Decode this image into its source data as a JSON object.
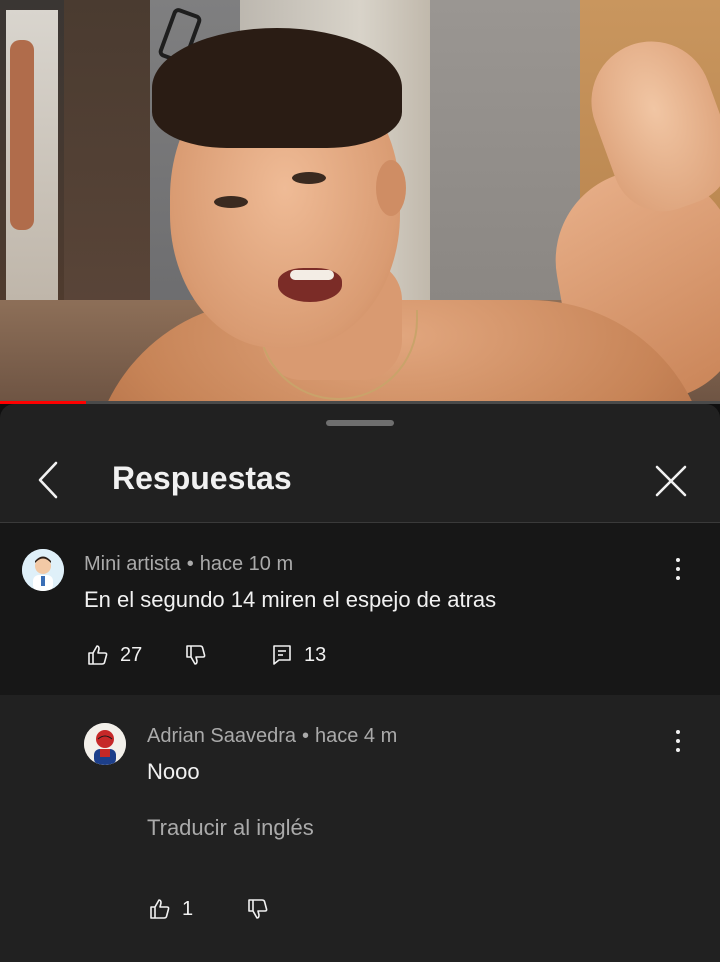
{
  "video": {
    "progress": 0.12
  },
  "panel": {
    "title": "Respuestas"
  },
  "parent_comment": {
    "author": "Mini artista",
    "time": "hace 10 m",
    "text": "En el segundo 14 miren el espejo de atras",
    "likes": "27",
    "replies": "13"
  },
  "reply": {
    "author": "Adrian Saavedra",
    "time": "hace 4 m",
    "text": "Nooo",
    "translate_label": "Traducir al inglés",
    "likes": "1"
  },
  "icons": {
    "back": "chevron-left-icon",
    "close": "close-icon",
    "like": "thumbs-up-icon",
    "dislike": "thumbs-down-icon",
    "reply": "reply-icon",
    "menu": "more-vert-icon"
  },
  "colors": {
    "progress": "#ff0000",
    "panel_bg": "#212121",
    "parent_bg": "#171717",
    "secondary_text": "#aaaaaa"
  }
}
